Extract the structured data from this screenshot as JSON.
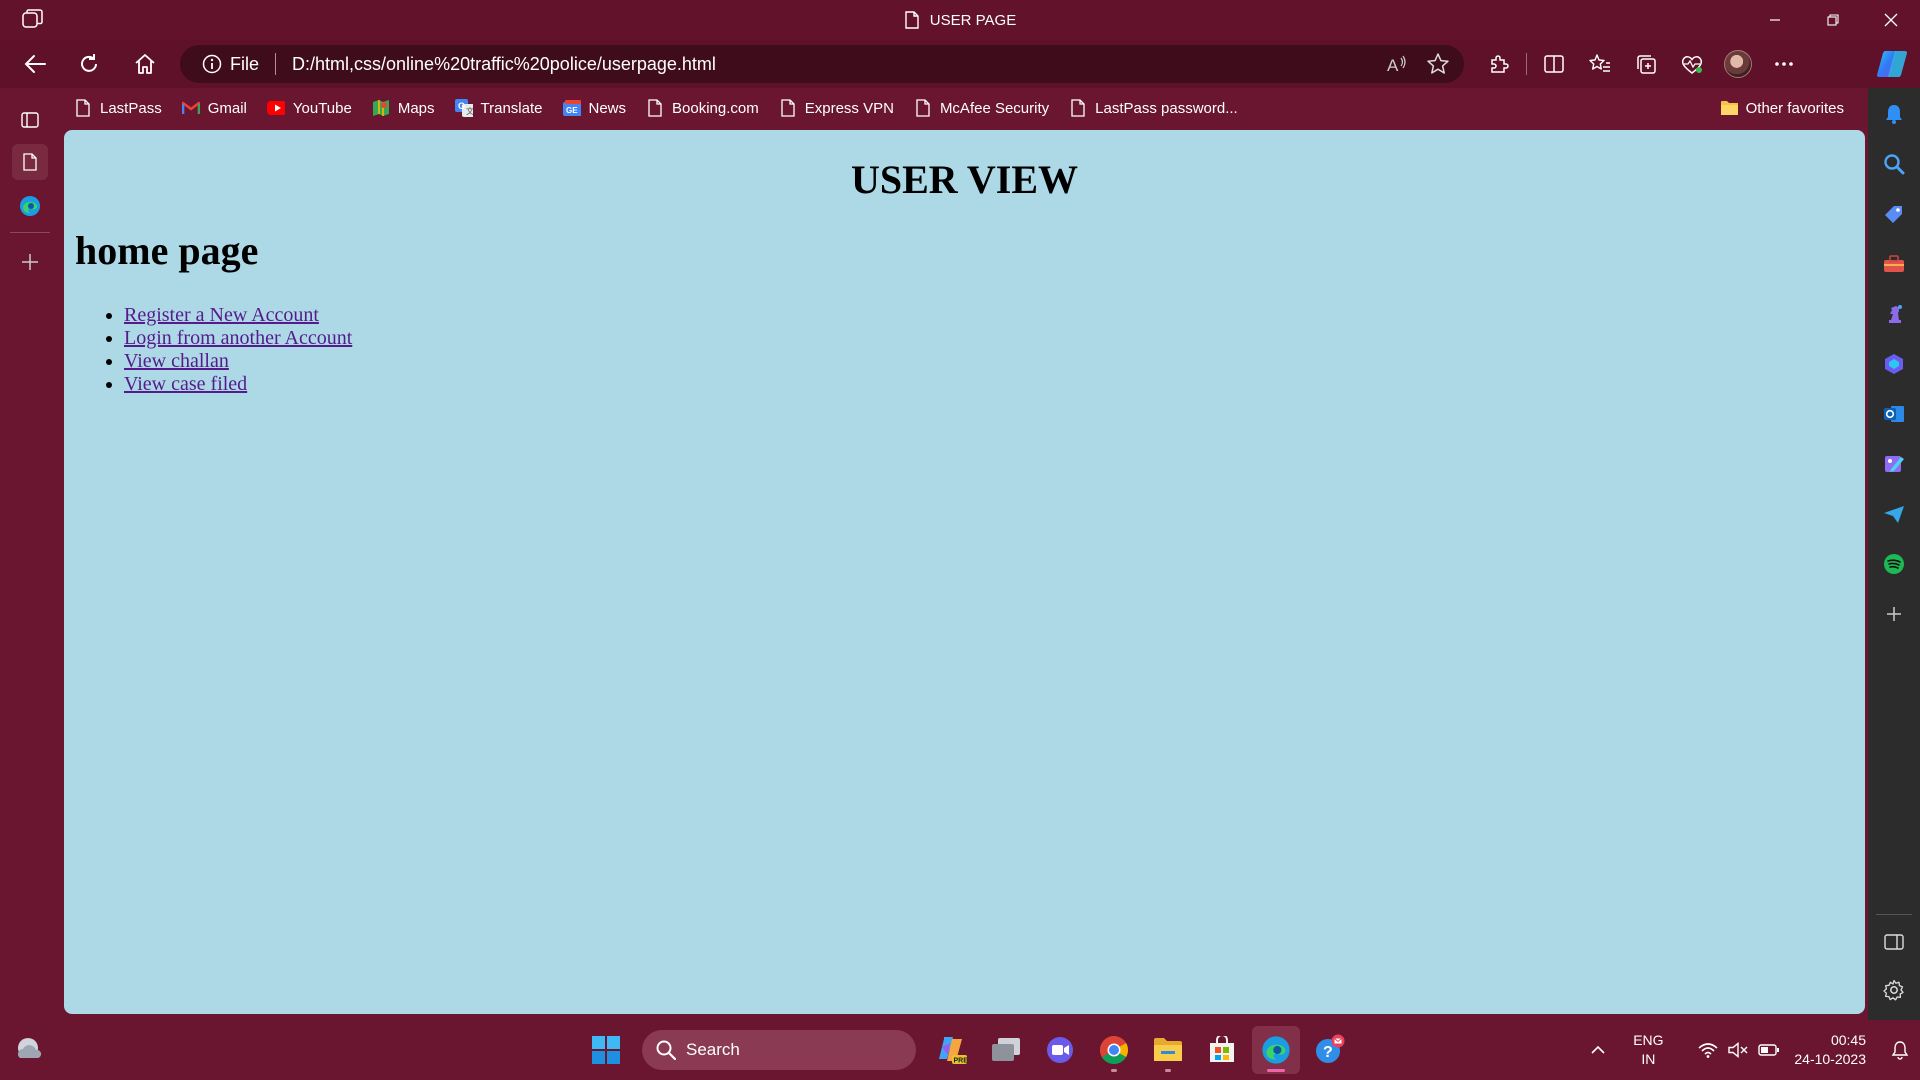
{
  "window": {
    "title": "USER PAGE",
    "colors": {
      "frame": "#62122b",
      "page_background": "#add8e6",
      "link": "#551a8b"
    }
  },
  "addressbar": {
    "site_info_label": "File",
    "url": "D:/html,css/online%20traffic%20police/userpage.html"
  },
  "favorites": {
    "items": [
      {
        "label": "LastPass",
        "icon": "page-icon"
      },
      {
        "label": "Gmail",
        "icon": "gmail-icon"
      },
      {
        "label": "YouTube",
        "icon": "youtube-icon"
      },
      {
        "label": "Maps",
        "icon": "maps-icon"
      },
      {
        "label": "Translate",
        "icon": "translate-icon"
      },
      {
        "label": "News",
        "icon": "news-icon"
      },
      {
        "label": "Booking.com",
        "icon": "page-icon"
      },
      {
        "label": "Express VPN",
        "icon": "page-icon"
      },
      {
        "label": "McAfee Security",
        "icon": "page-icon"
      },
      {
        "label": "LastPass password...",
        "icon": "page-icon"
      }
    ],
    "other_label": "Other favorites"
  },
  "page": {
    "heading": "USER VIEW",
    "subheading": "home page",
    "links": [
      {
        "label": "Register a New Account"
      },
      {
        "label": "Login from another Account"
      },
      {
        "label": "View challan"
      },
      {
        "label": "View case filed"
      }
    ]
  },
  "taskbar": {
    "search_label": "Search",
    "language": "ENG",
    "region": "IN",
    "time": "00:45",
    "date": "24-10-2023"
  }
}
